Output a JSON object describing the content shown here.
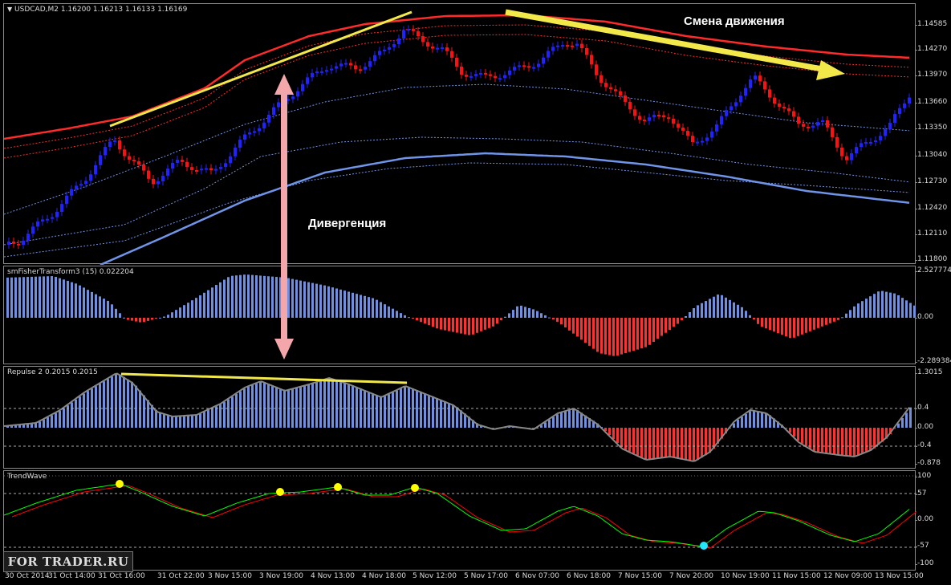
{
  "main": {
    "label": "USDCAD,M2  1.16200 1.16213 1.16133 1.16169",
    "price_axis": [
      "1.14585",
      "1.14270",
      "1.13970",
      "1.13660",
      "1.13350",
      "1.13040",
      "1.12730",
      "1.12420",
      "1.12110",
      "1.11800"
    ],
    "annotations": {
      "trend_change": "Смена движения",
      "divergence": "Дивергенция"
    }
  },
  "fisher": {
    "label": "smFisherTransform3 (15) 0.022204",
    "axis": [
      "2.527774",
      "0.00",
      "-2.289384"
    ]
  },
  "repulse": {
    "label": "Repulse 2 0.2015 0.2015",
    "axis": [
      "1.3015",
      "0.4",
      "0.00",
      "-0.4",
      "-0.878"
    ]
  },
  "trendwave": {
    "label": "TrendWave",
    "axis": [
      "100",
      "57",
      "0.00",
      "-57",
      "-100"
    ]
  },
  "time_axis": [
    "30 Oct 2014",
    "31 Oct 14:00",
    "31 Oct 16:00",
    "31 Oct 22:00",
    "3 Nov 15:00",
    "3 Nov 19:00",
    "4 Nov 13:00",
    "4 Nov 18:00",
    "5 Nov 12:00",
    "5 Nov 17:00",
    "6 Nov 07:00",
    "6 Nov 18:00",
    "7 Nov 15:00",
    "7 Nov 20:00",
    "10 Nov 19:00",
    "11 Nov 15:00",
    "12 Nov 09:00",
    "13 Nov 15:00"
  ],
  "watermark": "FOR TRADER.RU",
  "colors": {
    "bull_candle": "#2222ff",
    "bear_candle": "#ff1010",
    "envelope_outer": "#ff2a2a",
    "envelope_inner": "#6f94e8",
    "hist_positive": "#6f8fe0",
    "hist_negative": "#ff3030",
    "trend_line": "#f3e84a",
    "divergence_arrow": "#f3a7aa",
    "trendwave_fast": "#00ff00",
    "trendwave_slow": "#ff0000",
    "signal_top": "#ffff00",
    "signal_bottom": "#22e6ff"
  }
}
